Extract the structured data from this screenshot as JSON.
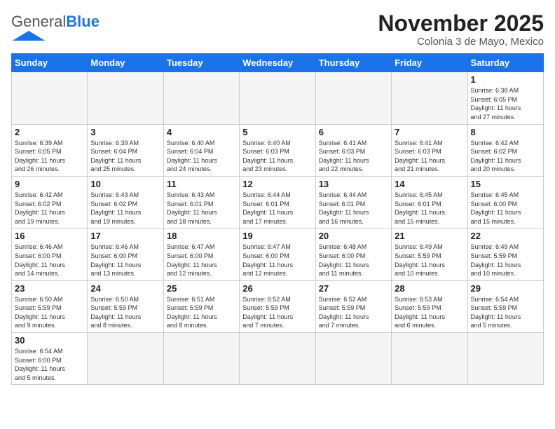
{
  "header": {
    "logo_general": "General",
    "logo_blue": "Blue",
    "month_title": "November 2025",
    "subtitle": "Colonia 3 de Mayo, Mexico"
  },
  "weekdays": [
    "Sunday",
    "Monday",
    "Tuesday",
    "Wednesday",
    "Thursday",
    "Friday",
    "Saturday"
  ],
  "weeks": [
    [
      {
        "day": "",
        "info": ""
      },
      {
        "day": "",
        "info": ""
      },
      {
        "day": "",
        "info": ""
      },
      {
        "day": "",
        "info": ""
      },
      {
        "day": "",
        "info": ""
      },
      {
        "day": "",
        "info": ""
      },
      {
        "day": "1",
        "info": "Sunrise: 6:38 AM\nSunset: 6:05 PM\nDaylight: 11 hours\nand 27 minutes."
      }
    ],
    [
      {
        "day": "2",
        "info": "Sunrise: 6:39 AM\nSunset: 6:05 PM\nDaylight: 11 hours\nand 26 minutes."
      },
      {
        "day": "3",
        "info": "Sunrise: 6:39 AM\nSunset: 6:04 PM\nDaylight: 11 hours\nand 25 minutes."
      },
      {
        "day": "4",
        "info": "Sunrise: 6:40 AM\nSunset: 6:04 PM\nDaylight: 11 hours\nand 24 minutes."
      },
      {
        "day": "5",
        "info": "Sunrise: 6:40 AM\nSunset: 6:03 PM\nDaylight: 11 hours\nand 23 minutes."
      },
      {
        "day": "6",
        "info": "Sunrise: 6:41 AM\nSunset: 6:03 PM\nDaylight: 11 hours\nand 22 minutes."
      },
      {
        "day": "7",
        "info": "Sunrise: 6:41 AM\nSunset: 6:03 PM\nDaylight: 11 hours\nand 21 minutes."
      },
      {
        "day": "8",
        "info": "Sunrise: 6:42 AM\nSunset: 6:02 PM\nDaylight: 11 hours\nand 20 minutes."
      }
    ],
    [
      {
        "day": "9",
        "info": "Sunrise: 6:42 AM\nSunset: 6:02 PM\nDaylight: 11 hours\nand 19 minutes."
      },
      {
        "day": "10",
        "info": "Sunrise: 6:43 AM\nSunset: 6:02 PM\nDaylight: 11 hours\nand 19 minutes."
      },
      {
        "day": "11",
        "info": "Sunrise: 6:43 AM\nSunset: 6:01 PM\nDaylight: 11 hours\nand 18 minutes."
      },
      {
        "day": "12",
        "info": "Sunrise: 6:44 AM\nSunset: 6:01 PM\nDaylight: 11 hours\nand 17 minutes."
      },
      {
        "day": "13",
        "info": "Sunrise: 6:44 AM\nSunset: 6:01 PM\nDaylight: 11 hours\nand 16 minutes."
      },
      {
        "day": "14",
        "info": "Sunrise: 6:45 AM\nSunset: 6:01 PM\nDaylight: 11 hours\nand 15 minutes."
      },
      {
        "day": "15",
        "info": "Sunrise: 6:45 AM\nSunset: 6:00 PM\nDaylight: 11 hours\nand 15 minutes."
      }
    ],
    [
      {
        "day": "16",
        "info": "Sunrise: 6:46 AM\nSunset: 6:00 PM\nDaylight: 11 hours\nand 14 minutes."
      },
      {
        "day": "17",
        "info": "Sunrise: 6:46 AM\nSunset: 6:00 PM\nDaylight: 11 hours\nand 13 minutes."
      },
      {
        "day": "18",
        "info": "Sunrise: 6:47 AM\nSunset: 6:00 PM\nDaylight: 11 hours\nand 12 minutes."
      },
      {
        "day": "19",
        "info": "Sunrise: 6:47 AM\nSunset: 6:00 PM\nDaylight: 11 hours\nand 12 minutes."
      },
      {
        "day": "20",
        "info": "Sunrise: 6:48 AM\nSunset: 6:00 PM\nDaylight: 11 hours\nand 11 minutes."
      },
      {
        "day": "21",
        "info": "Sunrise: 6:49 AM\nSunset: 5:59 PM\nDaylight: 11 hours\nand 10 minutes."
      },
      {
        "day": "22",
        "info": "Sunrise: 6:49 AM\nSunset: 5:59 PM\nDaylight: 11 hours\nand 10 minutes."
      }
    ],
    [
      {
        "day": "23",
        "info": "Sunrise: 6:50 AM\nSunset: 5:59 PM\nDaylight: 11 hours\nand 9 minutes."
      },
      {
        "day": "24",
        "info": "Sunrise: 6:50 AM\nSunset: 5:59 PM\nDaylight: 11 hours\nand 8 minutes."
      },
      {
        "day": "25",
        "info": "Sunrise: 6:51 AM\nSunset: 5:59 PM\nDaylight: 11 hours\nand 8 minutes."
      },
      {
        "day": "26",
        "info": "Sunrise: 6:52 AM\nSunset: 5:59 PM\nDaylight: 11 hours\nand 7 minutes."
      },
      {
        "day": "27",
        "info": "Sunrise: 6:52 AM\nSunset: 5:59 PM\nDaylight: 11 hours\nand 7 minutes."
      },
      {
        "day": "28",
        "info": "Sunrise: 6:53 AM\nSunset: 5:59 PM\nDaylight: 11 hours\nand 6 minutes."
      },
      {
        "day": "29",
        "info": "Sunrise: 6:54 AM\nSunset: 5:59 PM\nDaylight: 11 hours\nand 5 minutes."
      }
    ],
    [
      {
        "day": "30",
        "info": "Sunrise: 6:54 AM\nSunset: 6:00 PM\nDaylight: 11 hours\nand 5 minutes."
      },
      {
        "day": "",
        "info": ""
      },
      {
        "day": "",
        "info": ""
      },
      {
        "day": "",
        "info": ""
      },
      {
        "day": "",
        "info": ""
      },
      {
        "day": "",
        "info": ""
      },
      {
        "day": "",
        "info": ""
      }
    ]
  ]
}
